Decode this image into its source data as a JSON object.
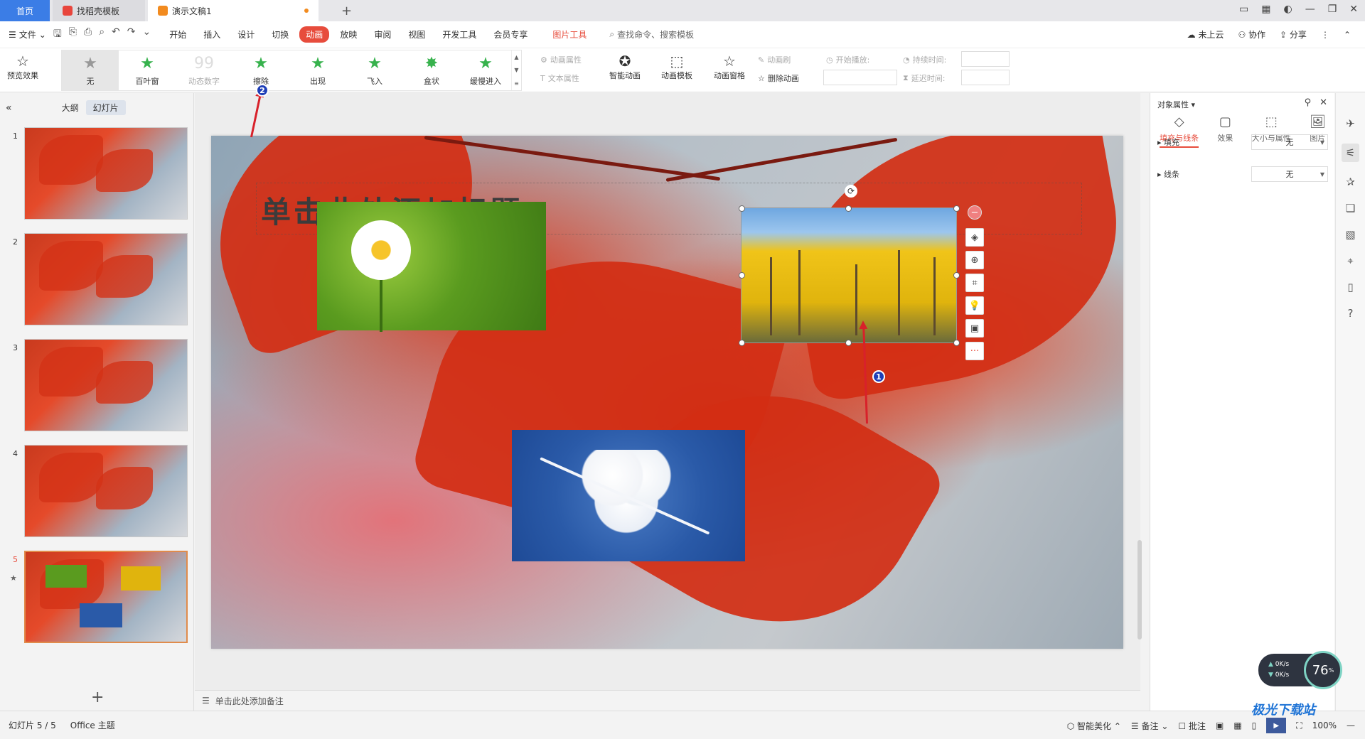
{
  "tabs": {
    "home": "首页",
    "t1": "找稻壳模板",
    "t2": "演示文稿1"
  },
  "menu": {
    "file": "文件",
    "items": [
      "开始",
      "插入",
      "设计",
      "切换",
      "动画",
      "放映",
      "审阅",
      "视图",
      "开发工具",
      "会员专享"
    ],
    "active": "动画",
    "picture_tools": "图片工具",
    "search": "查找命令、搜索模板",
    "cloud": "未上云",
    "collab": "协作",
    "share": "分享"
  },
  "ribbon": {
    "preview": "预览效果",
    "gallery": [
      {
        "label": "无",
        "state": "selected"
      },
      {
        "label": "百叶窗",
        "state": "normal"
      },
      {
        "label": "动态数字",
        "state": "dim"
      },
      {
        "label": "擦除",
        "state": "normal"
      },
      {
        "label": "出现",
        "state": "normal"
      },
      {
        "label": "飞入",
        "state": "normal"
      },
      {
        "label": "盒状",
        "state": "normal"
      },
      {
        "label": "缓慢进入",
        "state": "normal"
      }
    ],
    "anim_attr": "动画属性",
    "text_attr": "文本属性",
    "smart_anim": "智能动画",
    "anim_template": "动画模板",
    "anim_pane": "动画窗格",
    "anim_brush": "动画刷",
    "delete_anim": "删除动画",
    "start_play": "开始播放:",
    "duration": "持续时间:",
    "delay": "延迟时间:"
  },
  "leftpanel": {
    "outline": "大纲",
    "slides": "幻灯片",
    "slide_numbers": [
      "1",
      "2",
      "3",
      "4",
      "5"
    ],
    "active_slide": 5
  },
  "slide": {
    "title_placeholder": "单击此处添加标题"
  },
  "notes": {
    "placeholder": "单击此处添加备注"
  },
  "rightpanel": {
    "title": "对象属性",
    "tabs": [
      "填充与线条",
      "效果",
      "大小与属性",
      "图片"
    ],
    "fill_label": "填充",
    "fill_value": "无",
    "line_label": "线条",
    "line_value": "无"
  },
  "annotations": {
    "badge1": "1",
    "badge2": "2"
  },
  "status": {
    "slide_counter": "幻灯片 5 / 5",
    "theme": "Office 主题",
    "beautify": "智能美化",
    "notes": "备注",
    "comments": "批注",
    "zoom": "100%"
  },
  "netwidget": {
    "up": "0K/s",
    "down": "0K/s",
    "percent": "76",
    "unit": "%"
  },
  "watermark": "极光下载站"
}
